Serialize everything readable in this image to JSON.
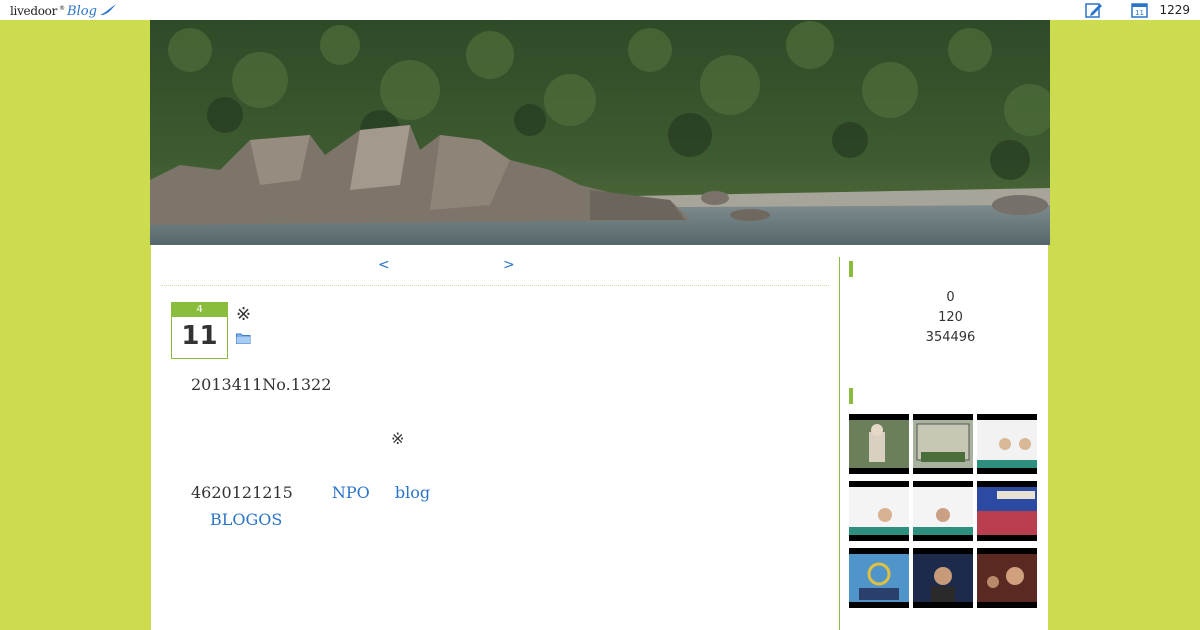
{
  "topbar": {
    "logo_text": "livedoor",
    "logo_blog": "Blog",
    "counter": "1229",
    "calendar_day": "11"
  },
  "nav": {
    "prev": "<",
    "next": ">"
  },
  "entry": {
    "month": "4",
    "day": "11",
    "title_mark": "※",
    "line1": "2013411No.1322",
    "center_mark": "※",
    "line2_text": "4620121215",
    "link_npo": "NPO",
    "link_blog": "blog",
    "link_blogos": "BLOGOS"
  },
  "sidebar": {
    "counters": [
      "0",
      "120",
      "354496"
    ],
    "thumbnails": [
      "video-thumbnail-1",
      "video-thumbnail-2",
      "video-thumbnail-3",
      "video-thumbnail-4",
      "video-thumbnail-5",
      "video-thumbnail-6",
      "video-thumbnail-7",
      "video-thumbnail-8",
      "video-thumbnail-9"
    ]
  },
  "colors": {
    "page_bg": "#cddb4f",
    "accent_green": "#8bbd3d",
    "link_blue": "#2a74c9"
  }
}
